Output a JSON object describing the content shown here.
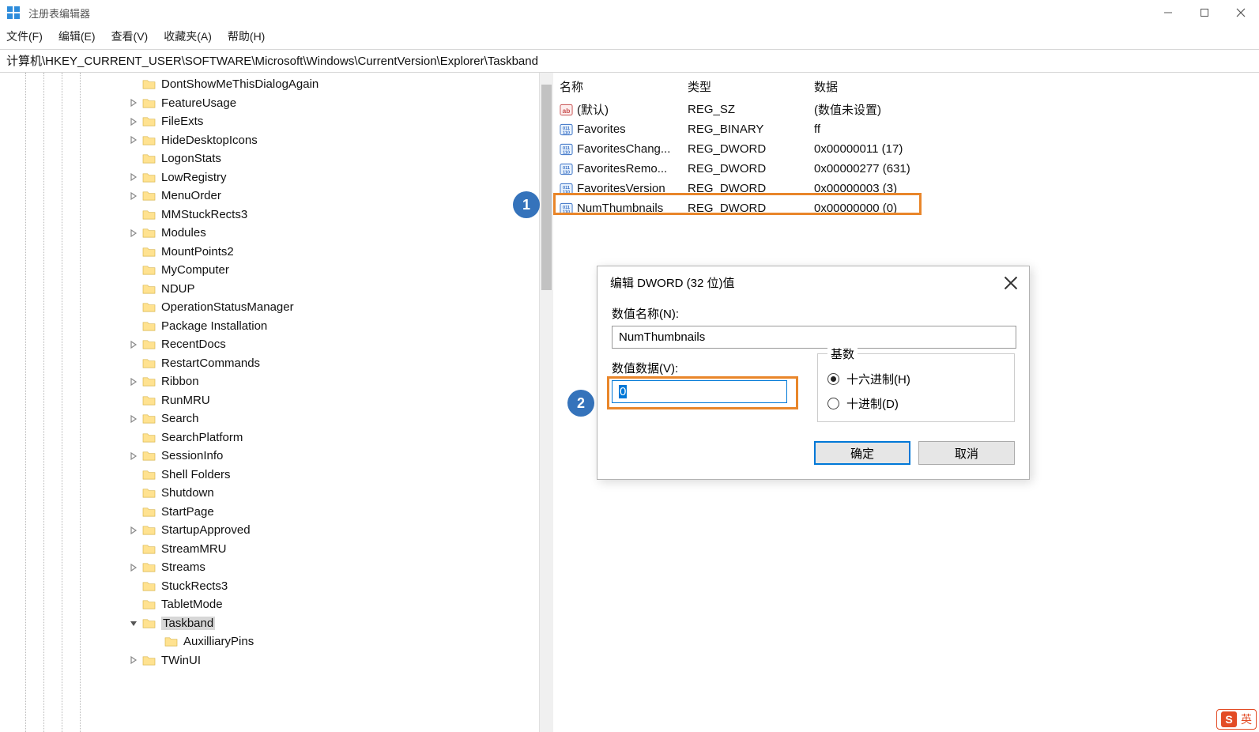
{
  "window": {
    "title": "注册表编辑器"
  },
  "menu": {
    "file": "文件(F)",
    "edit": "编辑(E)",
    "view": "查看(V)",
    "favorites": "收藏夹(A)",
    "help": "帮助(H)"
  },
  "address": "计算机\\HKEY_CURRENT_USER\\SOFTWARE\\Microsoft\\Windows\\CurrentVersion\\Explorer\\Taskband",
  "tree": [
    {
      "depth": 5,
      "expand": "",
      "label": "DontShowMeThisDialogAgain"
    },
    {
      "depth": 5,
      "expand": ">",
      "label": "FeatureUsage"
    },
    {
      "depth": 5,
      "expand": ">",
      "label": "FileExts"
    },
    {
      "depth": 5,
      "expand": ">",
      "label": "HideDesktopIcons"
    },
    {
      "depth": 5,
      "expand": "",
      "label": "LogonStats"
    },
    {
      "depth": 5,
      "expand": ">",
      "label": "LowRegistry"
    },
    {
      "depth": 5,
      "expand": ">",
      "label": "MenuOrder"
    },
    {
      "depth": 5,
      "expand": "",
      "label": "MMStuckRects3"
    },
    {
      "depth": 5,
      "expand": ">",
      "label": "Modules"
    },
    {
      "depth": 5,
      "expand": "",
      "label": "MountPoints2"
    },
    {
      "depth": 5,
      "expand": "",
      "label": "MyComputer"
    },
    {
      "depth": 5,
      "expand": "",
      "label": "NDUP"
    },
    {
      "depth": 5,
      "expand": "",
      "label": "OperationStatusManager"
    },
    {
      "depth": 5,
      "expand": "",
      "label": "Package Installation"
    },
    {
      "depth": 5,
      "expand": ">",
      "label": "RecentDocs"
    },
    {
      "depth": 5,
      "expand": "",
      "label": "RestartCommands"
    },
    {
      "depth": 5,
      "expand": ">",
      "label": "Ribbon"
    },
    {
      "depth": 5,
      "expand": "",
      "label": "RunMRU"
    },
    {
      "depth": 5,
      "expand": ">",
      "label": "Search"
    },
    {
      "depth": 5,
      "expand": "",
      "label": "SearchPlatform"
    },
    {
      "depth": 5,
      "expand": ">",
      "label": "SessionInfo"
    },
    {
      "depth": 5,
      "expand": "",
      "label": "Shell Folders"
    },
    {
      "depth": 5,
      "expand": "",
      "label": "Shutdown"
    },
    {
      "depth": 5,
      "expand": "",
      "label": "StartPage"
    },
    {
      "depth": 5,
      "expand": ">",
      "label": "StartupApproved"
    },
    {
      "depth": 5,
      "expand": "",
      "label": "StreamMRU"
    },
    {
      "depth": 5,
      "expand": ">",
      "label": "Streams"
    },
    {
      "depth": 5,
      "expand": "",
      "label": "StuckRects3"
    },
    {
      "depth": 5,
      "expand": "",
      "label": "TabletMode"
    },
    {
      "depth": 5,
      "expand": "v",
      "label": "Taskband",
      "selected": true
    },
    {
      "depth": 6,
      "expand": "",
      "label": "AuxilliaryPins"
    },
    {
      "depth": 5,
      "expand": ">",
      "label": "TWinUI"
    }
  ],
  "list": {
    "headers": {
      "name": "名称",
      "type": "类型",
      "data": "数据"
    },
    "rows": [
      {
        "icon": "sz",
        "name": "(默认)",
        "type": "REG_SZ",
        "data": "(数值未设置)"
      },
      {
        "icon": "bin",
        "name": "Favorites",
        "type": "REG_BINARY",
        "data": "ff"
      },
      {
        "icon": "bin",
        "name": "FavoritesChang...",
        "type": "REG_DWORD",
        "data": "0x00000011 (17)"
      },
      {
        "icon": "bin",
        "name": "FavoritesRemo...",
        "type": "REG_DWORD",
        "data": "0x00000277 (631)"
      },
      {
        "icon": "bin",
        "name": "FavoritesVersion",
        "type": "REG_DWORD",
        "data": "0x00000003 (3)"
      },
      {
        "icon": "bin",
        "name": "NumThumbnails",
        "type": "REG_DWORD",
        "data": "0x00000000 (0)",
        "highlighted": true
      }
    ]
  },
  "dialog": {
    "title": "编辑 DWORD (32 位)值",
    "name_label": "数值名称(N):",
    "name_value": "NumThumbnails",
    "data_label": "数值数据(V):",
    "data_value": "0",
    "base_label": "基数",
    "radio_hex": "十六进制(H)",
    "radio_dec": "十进制(D)",
    "ok": "确定",
    "cancel": "取消"
  },
  "annotations": {
    "b1": "1",
    "b2": "2"
  },
  "ime": {
    "logo": "S",
    "lang": "英"
  }
}
